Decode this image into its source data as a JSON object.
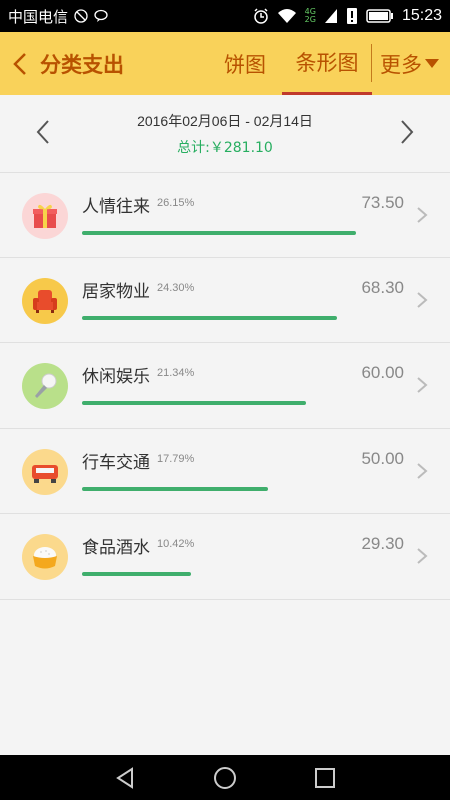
{
  "status_bar": {
    "carrier": "中国电信",
    "time": "15:23",
    "network_top": "4G",
    "network_bottom": "2G"
  },
  "appbar": {
    "title": "分类支出",
    "tabs": [
      {
        "label": "饼图",
        "active": false
      },
      {
        "label": "条形图",
        "active": true
      }
    ],
    "more_label": "更多",
    "colors": {
      "background": "#f9d25a",
      "accent": "#b85200",
      "tab_underline": "#c0392b"
    }
  },
  "range": {
    "date_range": "2016年02月06日 - 02月14日",
    "total": "总计:￥281.10"
  },
  "categories": [
    {
      "name": "人情往来",
      "percent": "26.15%",
      "amount": "73.50",
      "share": 0.2615,
      "icon": "gift-icon",
      "icon_bg": "#fbd6d6"
    },
    {
      "name": "居家物业",
      "percent": "24.30%",
      "amount": "68.30",
      "share": 0.243,
      "icon": "armchair-icon",
      "icon_bg": "#f7c94a"
    },
    {
      "name": "休闲娱乐",
      "percent": "21.34%",
      "amount": "60.00",
      "share": 0.2134,
      "icon": "microphone-icon",
      "icon_bg": "#b9e08a"
    },
    {
      "name": "行车交通",
      "percent": "17.79%",
      "amount": "50.00",
      "share": 0.1779,
      "icon": "car-icon",
      "icon_bg": "#fbd98c"
    },
    {
      "name": "食品酒水",
      "percent": "10.42%",
      "amount": "29.30",
      "share": 0.1042,
      "icon": "rice-bowl-icon",
      "icon_bg": "#fbd98c"
    }
  ],
  "bar_color": "#3fae6c",
  "nav": {
    "back": "back-triangle-icon",
    "home": "home-circle-icon",
    "recents": "recents-square-icon"
  }
}
